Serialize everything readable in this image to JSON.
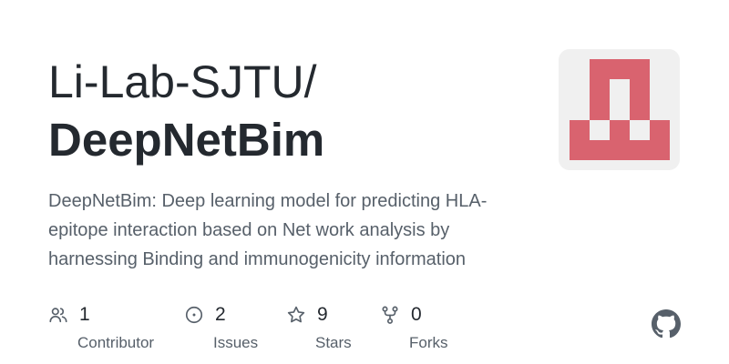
{
  "repo": {
    "owner": "Li-Lab-SJTU/",
    "name": "DeepNetBim",
    "description": "DeepNetBim: Deep learning model for predicting HLA-epitope interaction based on Net work analysis by harnessing Binding and immunogenicity information"
  },
  "avatar": {
    "icon": "org-logo-icon",
    "color": "#d9636f",
    "background": "#f0f0f0"
  },
  "stats": [
    {
      "icon": "people-icon",
      "value": "1",
      "label": "Contributor"
    },
    {
      "icon": "issue-circle-icon",
      "value": "2",
      "label": "Issues"
    },
    {
      "icon": "star-icon",
      "value": "9",
      "label": "Stars"
    },
    {
      "icon": "fork-icon",
      "value": "0",
      "label": "Forks"
    }
  ],
  "brand": {
    "icon": "github-mark-icon",
    "color": "#57606a"
  }
}
